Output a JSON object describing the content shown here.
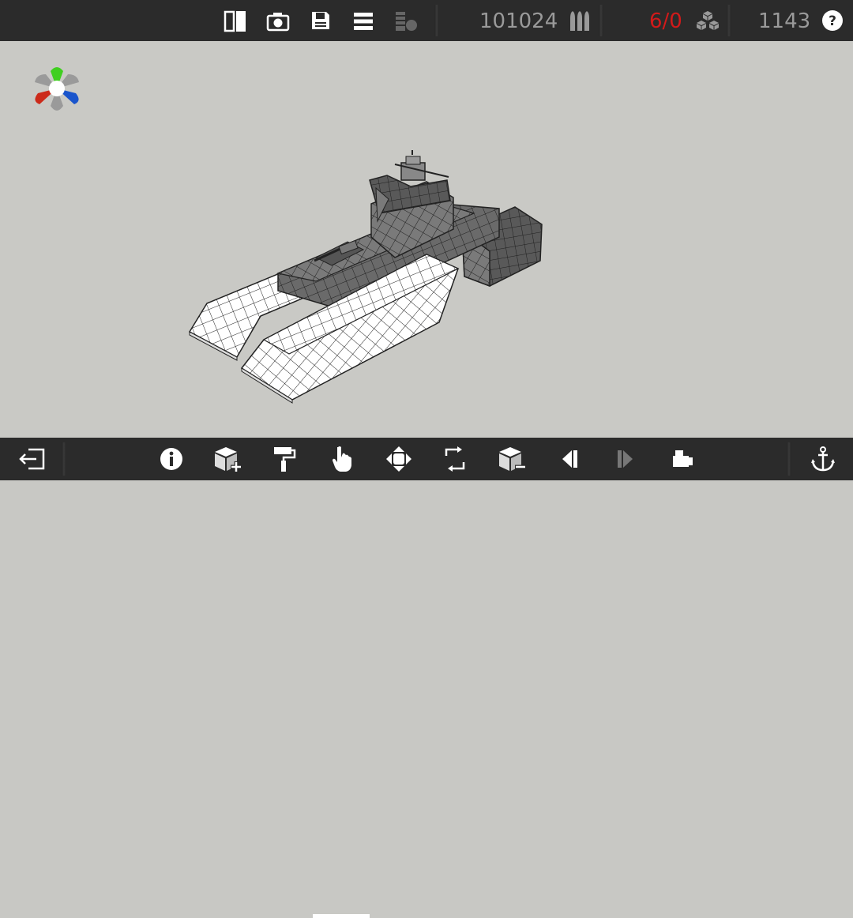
{
  "stats": {
    "cost_value": "101024",
    "parts_ratio": "6/0",
    "blocks_value": "1143"
  },
  "colors": {
    "bar_bg": "#2b2b2b",
    "viewport_bg": "#c9c9c5",
    "stat_gray": "#9a9a9a",
    "stat_red": "#d11a1a",
    "axis_green": "#3fcf1f",
    "axis_red": "#cc2a1a",
    "axis_blue": "#1a55cc"
  },
  "top_toolbar": {
    "icons": [
      "split-view-icon",
      "camera-icon",
      "save-icon",
      "menu-icon",
      "weight-icon",
      "ammo-icon",
      "blocks-icon",
      "help-icon"
    ]
  },
  "bottom_toolbar": {
    "icons": [
      "exit-icon",
      "info-icon",
      "add-block-icon",
      "paint-roller-icon",
      "touch-select-icon",
      "move-icon",
      "rotate-icon",
      "remove-block-icon",
      "previous-icon",
      "next-icon",
      "spawn-icon",
      "anchor-icon"
    ],
    "active": "touch-select-icon"
  }
}
